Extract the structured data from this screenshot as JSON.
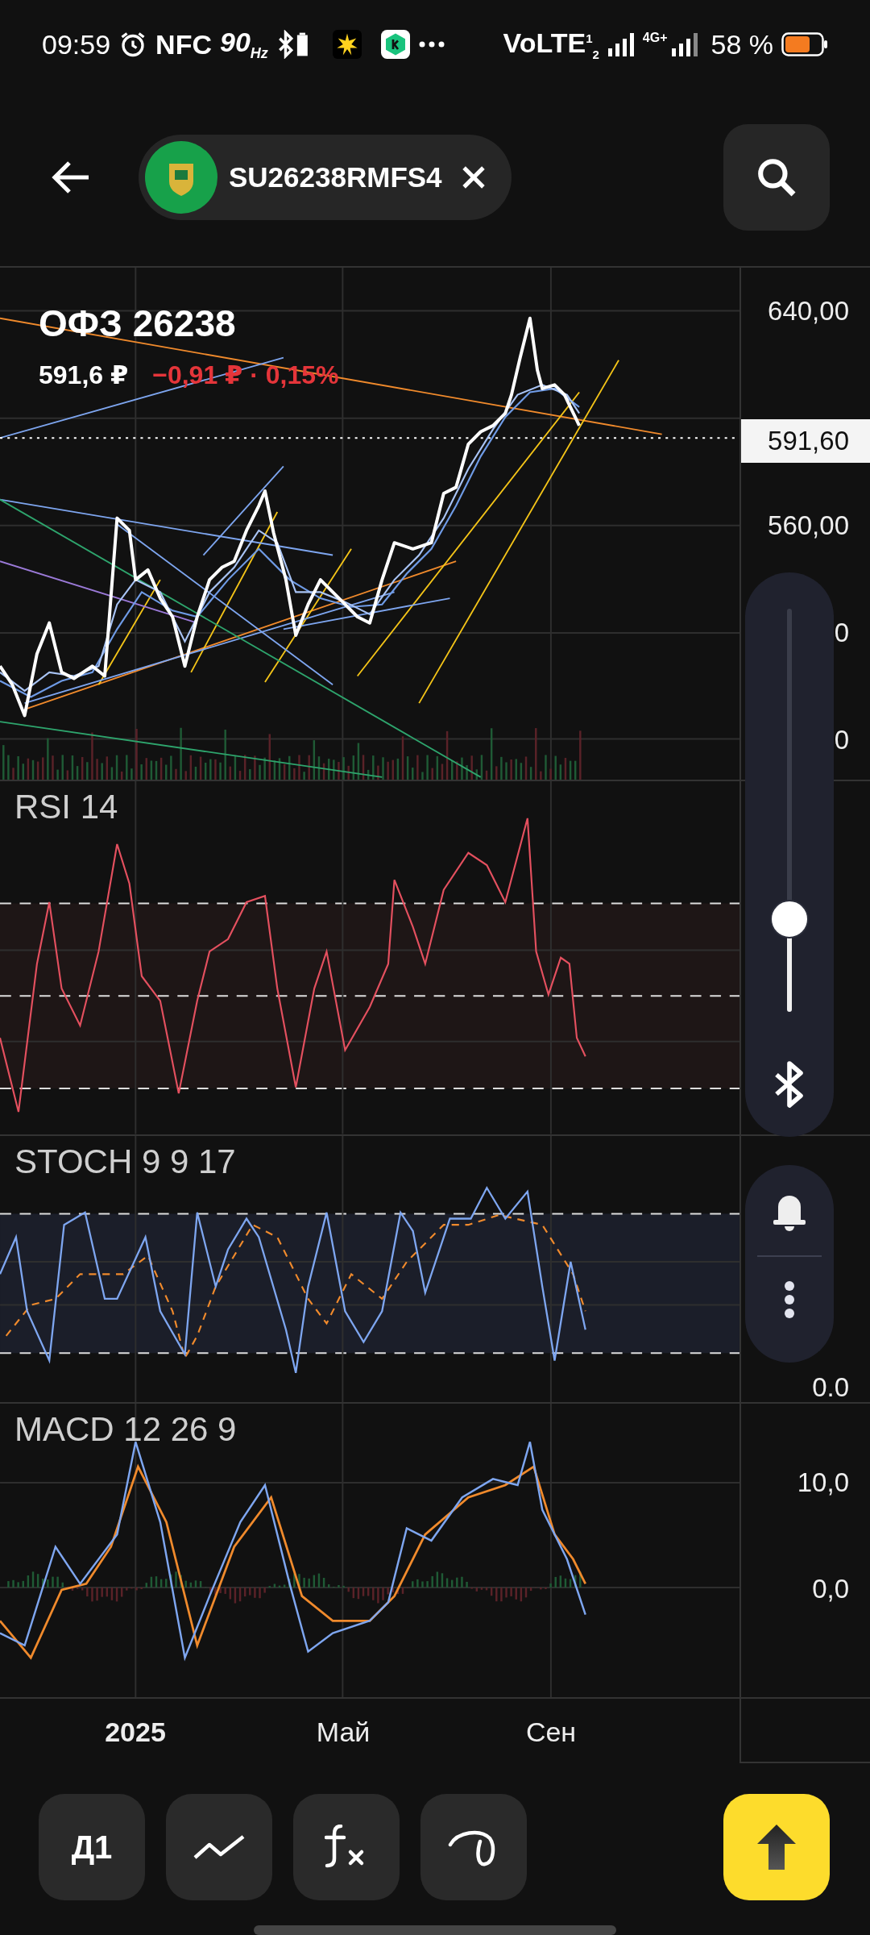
{
  "status_bar": {
    "time": "09:59",
    "nfc": "NFC",
    "refresh_rate": "90$_{Hz}$",
    "network": "VoLTE$^{1}$$_{2}$",
    "mobile_data": "4G+",
    "battery": "58 %"
  },
  "header": {
    "instrument_chip": {
      "ticker": "SU26238RMFS4"
    }
  },
  "quote": {
    "name": "ОФЗ 26238",
    "price": "591,6 ₽",
    "change": "−0,91 ₽ · 0,15%"
  },
  "price_axis": {
    "labels": [
      "640,00",
      "560,00",
      "0",
      "0"
    ],
    "current_price": "591,60"
  },
  "indicators": [
    {
      "kind": "rsi",
      "label": "RSI 14"
    },
    {
      "kind": "stoch",
      "label": "STOCH 9 9 17",
      "axis_labels": [
        "0.0"
      ]
    },
    {
      "kind": "macd",
      "label": "MACD 12 26 9",
      "axis_labels": [
        "10,0",
        "0,0"
      ]
    }
  ],
  "x_axis": [
    {
      "label": "2025",
      "kind": "year"
    },
    {
      "label": "Май",
      "kind": "month"
    },
    {
      "label": "Сен",
      "kind": "month"
    }
  ],
  "toolbar": {
    "interval": "Д1"
  },
  "volume_panel": {
    "level": 0.23
  }
}
